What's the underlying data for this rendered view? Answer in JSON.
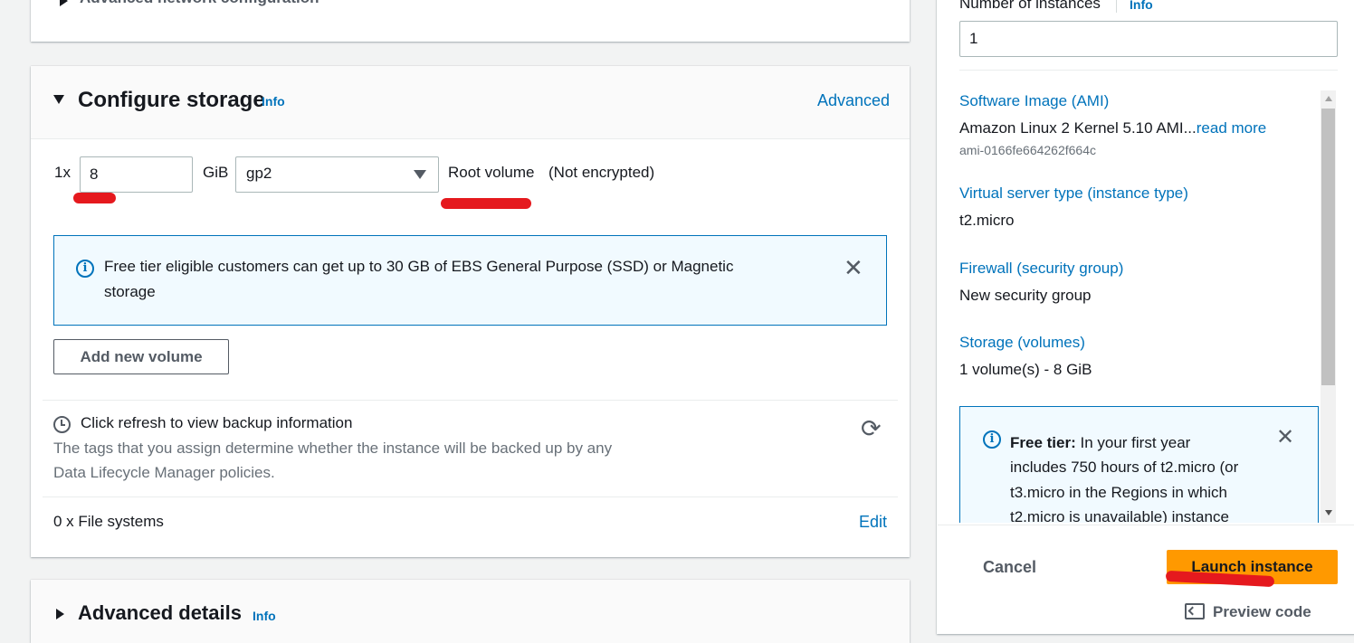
{
  "network": {
    "collapsed_title": "Advanced network configuration"
  },
  "storage": {
    "title": "Configure storage",
    "info_label": "Info",
    "advanced_link": "Advanced",
    "volume": {
      "count_prefix": "1x",
      "size_value": "8",
      "size_unit": "GiB",
      "volume_type": "gp2",
      "root_label": "Root volume",
      "encryption": "(Not encrypted)"
    },
    "alert": {
      "text_line1": "Free tier eligible customers can get up to 30 GB of EBS General Purpose (SSD) or Magnetic",
      "text_line2": "storage"
    },
    "add_volume_button": "Add new volume",
    "backup": {
      "title": "Click refresh to view backup information",
      "desc_line1": "The tags that you assign determine whether the instance will be backed up by any",
      "desc_line2": "Data Lifecycle Manager policies."
    },
    "file_systems": {
      "label": "0 x File systems",
      "edit_link": "Edit"
    }
  },
  "advanced_details": {
    "title": "Advanced details",
    "info_label": "Info"
  },
  "summary": {
    "instances_label": "Number of instances",
    "instances_info": "Info",
    "instances_value": "1",
    "ami_label": "Software Image (AMI)",
    "ami_value": "Amazon Linux 2 Kernel 5.10 AMI...",
    "ami_read_more": "read more",
    "ami_id": "ami-0166fe664262f664c",
    "instance_type_label": "Virtual server type (instance type)",
    "instance_type_value": "t2.micro",
    "firewall_label": "Firewall (security group)",
    "firewall_value": "New security group",
    "storage_label": "Storage (volumes)",
    "storage_value": "1 volume(s) - 8 GiB",
    "free_tier": {
      "bold": "Free tier:",
      "line1": " In your first year",
      "line2": "includes 750 hours of t2.micro (or",
      "line3": "t3.micro in the Regions in which",
      "line4": "t2.micro is unavailable) instance"
    },
    "cancel_button": "Cancel",
    "launch_button": "Launch instance",
    "preview_code": "Preview code"
  },
  "colors": {
    "link": "#0073bb",
    "primary_button": "#ff9900",
    "alert_border": "#0073bb",
    "alert_bg": "#f1faff",
    "annotation_red": "#e5191e"
  }
}
